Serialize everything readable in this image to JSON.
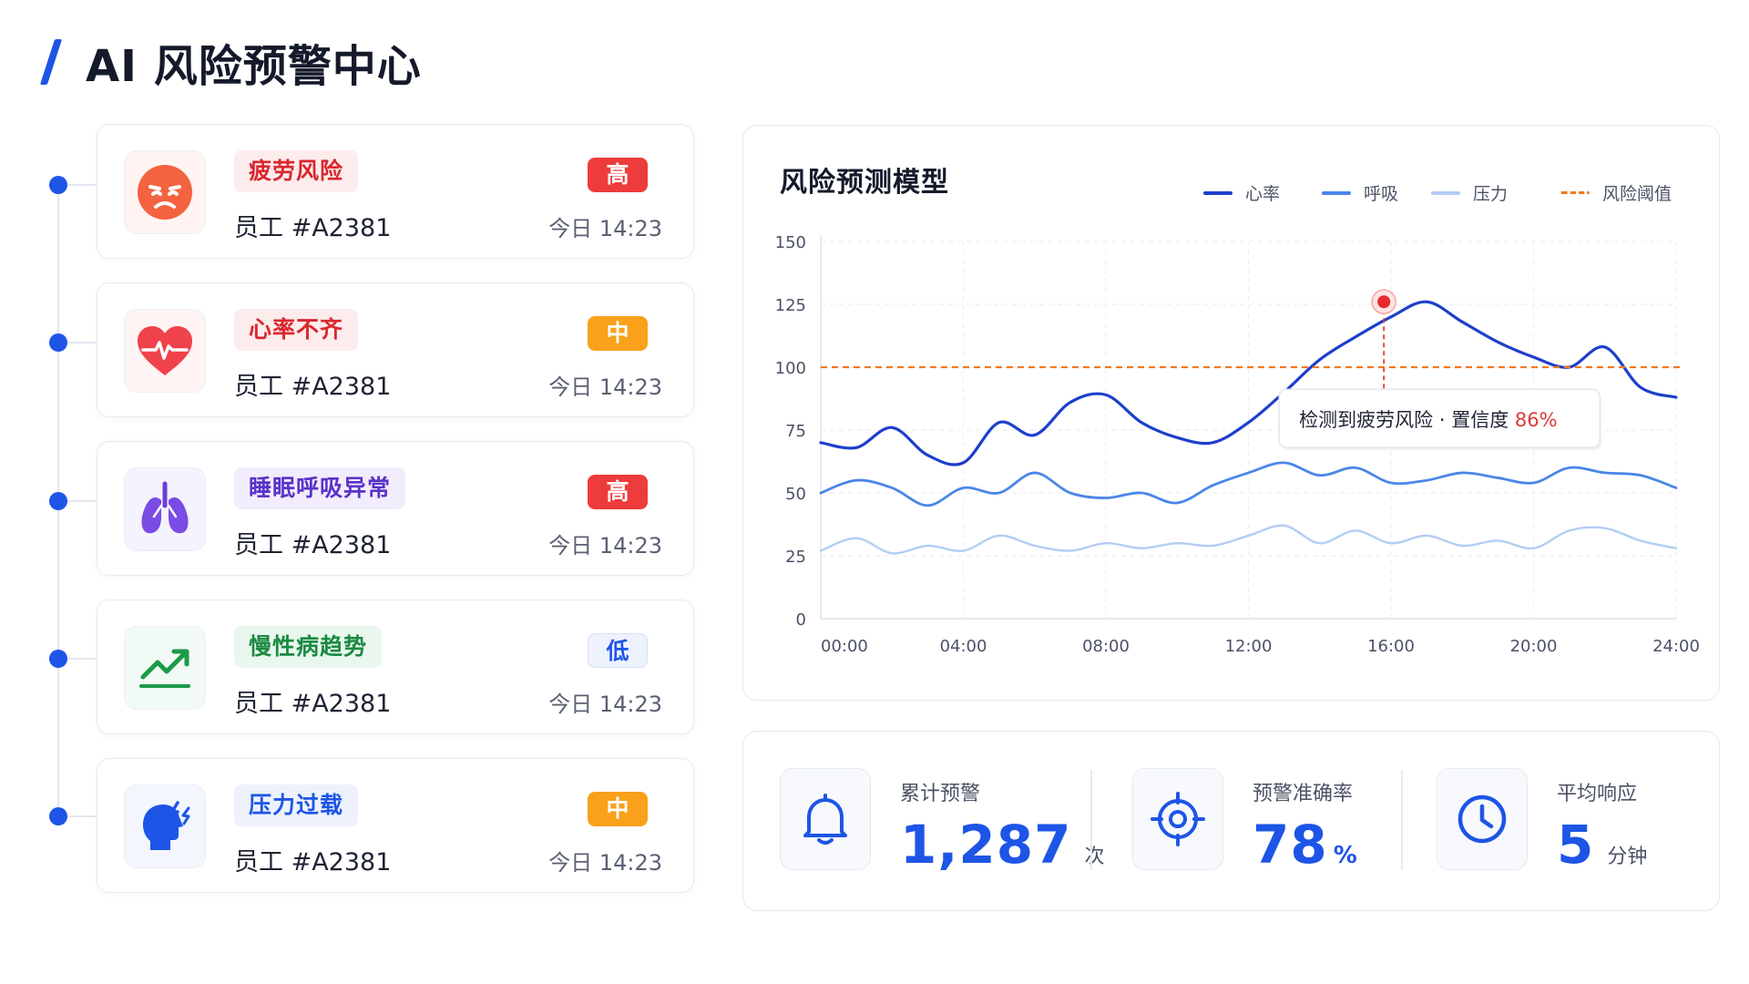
{
  "header": {
    "title": "AI 风险预警中心"
  },
  "alerts": [
    {
      "tag": "疲劳风险",
      "employee": "员工 #A2381",
      "level": "高",
      "time": "今日 14:23",
      "icon": "tired-face-icon"
    },
    {
      "tag": "心率不齐",
      "employee": "员工 #A2381",
      "level": "中",
      "time": "今日 14:23",
      "icon": "heart-pulse-icon"
    },
    {
      "tag": "睡眠呼吸异常",
      "employee": "员工 #A2381",
      "level": "高",
      "time": "今日 14:23",
      "icon": "lungs-icon"
    },
    {
      "tag": "慢性病趋势",
      "employee": "员工 #A2381",
      "level": "低",
      "time": "今日 14:23",
      "icon": "trend-up-icon"
    },
    {
      "tag": "压力过载",
      "employee": "员工 #A2381",
      "level": "中",
      "time": "今日 14:23",
      "icon": "stressed-head-icon"
    }
  ],
  "colors": {
    "accent": "#1e55e6",
    "high": "#ee3b3b",
    "medium": "#f9a11b",
    "low_bg": "#eef2fc",
    "low_text": "#1e55e6",
    "heart_rate": "#1d3fcc",
    "breath": "#4a86e8",
    "pressure": "#b3cdf4",
    "threshold": "#f07a1f"
  },
  "chart_data": {
    "type": "line",
    "title": "风险预测模型",
    "xlabel": "",
    "ylabel": "",
    "x": [
      0,
      1,
      2,
      3,
      4,
      5,
      6,
      7,
      8,
      9,
      10,
      11,
      12,
      13,
      14,
      15,
      16,
      17,
      18,
      19,
      20,
      21,
      22,
      23,
      24
    ],
    "x_ticks": [
      "00:00",
      "04:00",
      "08:00",
      "12:00",
      "16:00",
      "20:00",
      "24:00"
    ],
    "y_ticks": [
      0,
      25,
      50,
      75,
      100,
      125,
      150
    ],
    "ylim": [
      0,
      150
    ],
    "xlim": [
      0,
      24
    ],
    "grid": true,
    "legend_position": "top-right",
    "series": [
      {
        "name": "心率",
        "values": [
          70,
          68,
          76,
          65,
          62,
          78,
          73,
          86,
          89,
          78,
          72,
          70,
          78,
          90,
          103,
          112,
          120,
          126,
          118,
          110,
          104,
          100,
          108,
          92,
          88
        ]
      },
      {
        "name": "呼吸",
        "values": [
          50,
          55,
          52,
          45,
          52,
          50,
          58,
          50,
          48,
          50,
          46,
          53,
          58,
          62,
          57,
          60,
          54,
          55,
          58,
          56,
          54,
          60,
          58,
          57,
          52
        ]
      },
      {
        "name": "压力",
        "values": [
          27,
          32,
          26,
          29,
          27,
          33,
          29,
          27,
          30,
          28,
          30,
          29,
          33,
          37,
          30,
          35,
          30,
          33,
          29,
          31,
          28,
          35,
          36,
          31,
          28
        ]
      }
    ],
    "threshold": {
      "name": "风险阈值",
      "value": 100
    },
    "annotation": {
      "x": 15.8,
      "y": 126,
      "text": "检测到疲劳风险",
      "separator": "·",
      "confidence_label": "置信度",
      "confidence_value": "86%"
    }
  },
  "stats": [
    {
      "label": "累计预警",
      "value": "1,287",
      "unit": "次",
      "icon": "bell-icon"
    },
    {
      "label": "预警准确率",
      "value": "78",
      "unit": "%",
      "icon": "target-icon"
    },
    {
      "label": "平均响应",
      "value": "5",
      "unit": "分钟",
      "icon": "clock-icon"
    }
  ]
}
